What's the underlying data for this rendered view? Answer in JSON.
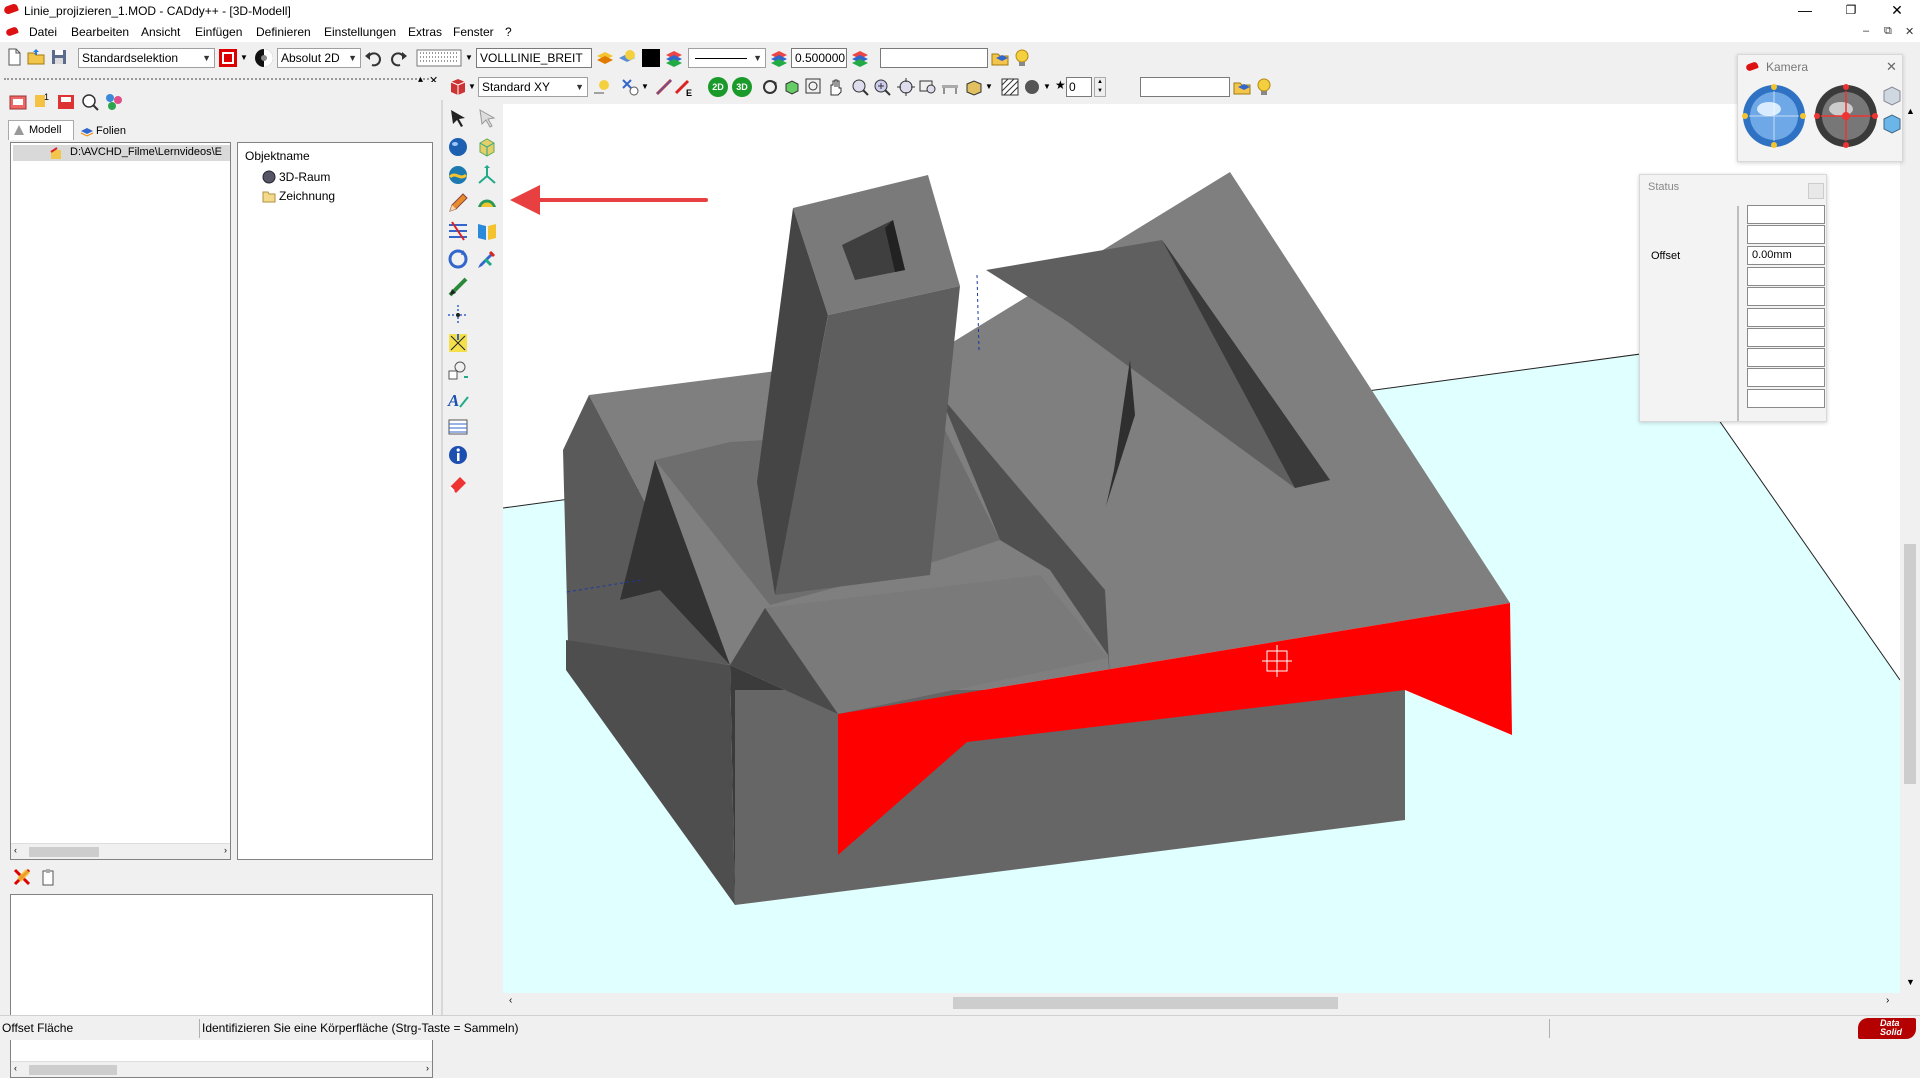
{
  "window": {
    "title": "Linie_projizieren_1.MOD  -  CADdy++ - [3D-Modell]",
    "minimize_glyph": "—",
    "restore_glyph": "❐",
    "close_glyph": "✕"
  },
  "menu": {
    "items": [
      "Datei",
      "Bearbeiten",
      "Ansicht",
      "Einfügen",
      "Definieren",
      "Einstellungen",
      "Extras",
      "Fenster",
      "?"
    ],
    "mdi_minimize": "–",
    "mdi_restore": "⧉",
    "mdi_close": "✕"
  },
  "toolbar1": {
    "selection_mode": "Standardselektion",
    "coord_mode": "Absolut 2D",
    "linetype": "VOLLLINIE_BREIT",
    "lineweight": "0.500000",
    "layer_field": ""
  },
  "toolbar2": {
    "view_mode": "Standard XY",
    "badge_2d": "2D",
    "badge_3d": "3D",
    "spin_value": "0",
    "search_field": ""
  },
  "left_panel": {
    "tabs": [
      "Modell",
      "Folien"
    ],
    "tree_path": "D:\\AVCHD_Filme\\Lernvideos\\E",
    "object_header": "Objektname",
    "objects": [
      "3D-Raum",
      "Zeichnung"
    ],
    "pin_glyph": "▴",
    "close_glyph": "✕"
  },
  "camera_panel": {
    "title": "Kamera",
    "close_glyph": "✕"
  },
  "status_panel": {
    "title": "Status",
    "offset_label": "Offset",
    "offset_value": "0.00mm"
  },
  "statusbar": {
    "left": "Offset Fläche",
    "message": "Identifizieren Sie eine Körperfläche (Strg-Taste = Sammeln)",
    "brand_top": "Data",
    "brand_bottom": "Solid"
  },
  "colors": {
    "highlight_face": "#ff0000",
    "floor": "#e0ffff",
    "annotation_arrow": "#e84040",
    "body_top": "#7f7f7f",
    "body_side": "#5e5e5e",
    "body_dark": "#3b3b3b"
  }
}
